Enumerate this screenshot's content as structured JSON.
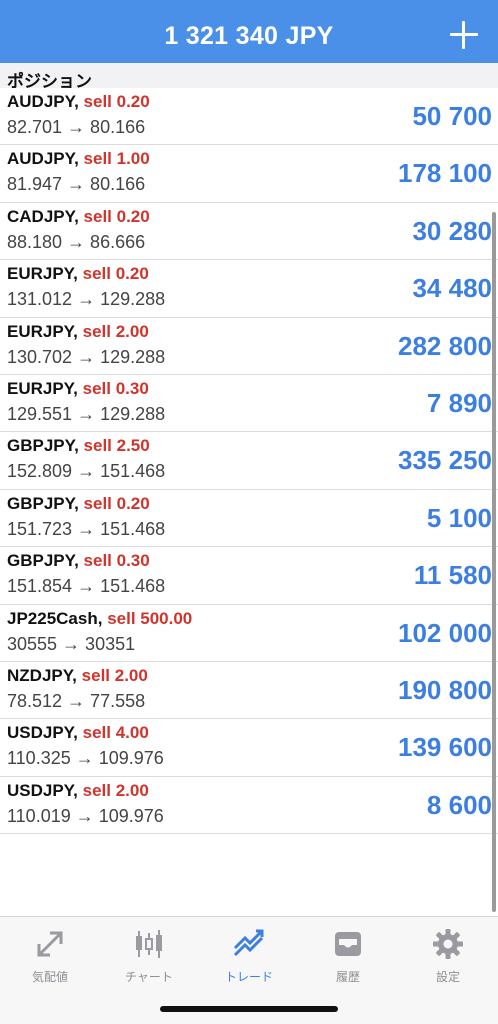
{
  "header": {
    "title": "1 321 340 JPY",
    "add_icon": "plus-icon"
  },
  "section": {
    "title": "ポジション"
  },
  "positions": [
    {
      "symbol": "AUDJPY,",
      "side": "sell 0.20",
      "prices": "82.701 → 80.166",
      "profit": "50 700"
    },
    {
      "symbol": "AUDJPY,",
      "side": "sell 1.00",
      "prices": "81.947 → 80.166",
      "profit": "178 100"
    },
    {
      "symbol": "CADJPY,",
      "side": "sell 0.20",
      "prices": "88.180 → 86.666",
      "profit": "30 280"
    },
    {
      "symbol": "EURJPY,",
      "side": "sell 0.20",
      "prices": "131.012 → 129.288",
      "profit": "34 480"
    },
    {
      "symbol": "EURJPY,",
      "side": "sell 2.00",
      "prices": "130.702 → 129.288",
      "profit": "282 800"
    },
    {
      "symbol": "EURJPY,",
      "side": "sell 0.30",
      "prices": "129.551 → 129.288",
      "profit": "7 890"
    },
    {
      "symbol": "GBPJPY,",
      "side": "sell 2.50",
      "prices": "152.809 → 151.468",
      "profit": "335 250"
    },
    {
      "symbol": "GBPJPY,",
      "side": "sell 0.20",
      "prices": "151.723 → 151.468",
      "profit": "5 100"
    },
    {
      "symbol": "GBPJPY,",
      "side": "sell 0.30",
      "prices": "151.854 → 151.468",
      "profit": "11 580"
    },
    {
      "symbol": "JP225Cash,",
      "side": "sell 500.00",
      "prices": "30555 → 30351",
      "profit": "102 000"
    },
    {
      "symbol": "NZDJPY,",
      "side": "sell 2.00",
      "prices": "78.512 → 77.558",
      "profit": "190 800"
    },
    {
      "symbol": "USDJPY,",
      "side": "sell 4.00",
      "prices": "110.325 → 109.976",
      "profit": "139 600"
    },
    {
      "symbol": "USDJPY,",
      "side": "sell 2.00",
      "prices": "110.019 → 109.976",
      "profit": "8 600"
    }
  ],
  "tabs": [
    {
      "label": "気配値",
      "icon": "quotes-icon",
      "active": false
    },
    {
      "label": "チャート",
      "icon": "candlestick-icon",
      "active": false
    },
    {
      "label": "トレード",
      "icon": "trade-icon",
      "active": true
    },
    {
      "label": "履歴",
      "icon": "history-icon",
      "active": false
    },
    {
      "label": "設定",
      "icon": "settings-icon",
      "active": false
    }
  ],
  "colors": {
    "header_bg": "#4a90e8",
    "profit": "#3d7fe0",
    "sell": "#d0342c",
    "tab_active": "#3d7fe0",
    "tab_inactive": "#8e8e93"
  }
}
